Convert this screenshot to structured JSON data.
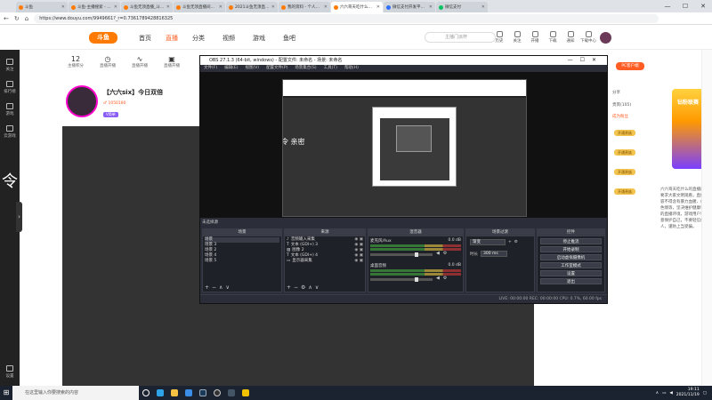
{
  "browser": {
    "tabs": [
      {
        "title": "斗鱼"
      },
      {
        "title": "斗鱼-主播搜索 - 斗鱼直…"
      },
      {
        "title": "斗鱼无须直播_斗鱼直播间…"
      },
      {
        "title": "斗鱼无须直播间直播…"
      },
      {
        "title": "2021斗鱼无须直播间直播…"
      },
      {
        "title": "我的资料 - 个人中心 - 斗鱼"
      },
      {
        "title": "六六哥天吃什么直播_斗鱼…"
      },
      {
        "title": "微信支付开发平台_百度搜索"
      },
      {
        "title": "微信支付"
      }
    ],
    "url": "https://www.douyu.com/9949661?_r=0.7361789428816325",
    "window_controls": [
      "—",
      "☐",
      "✕"
    ]
  },
  "douyu": {
    "logo_text": "斗鱼",
    "nav": [
      "首页",
      "直播",
      "分类",
      "视频",
      "游戏",
      "鱼吧"
    ],
    "nav_active_index": 1,
    "search_placeholder": "主播门派杯",
    "tools": [
      "历史",
      "关注",
      "开播",
      "下载",
      "通知",
      "下载中心"
    ],
    "room_top": [
      {
        "value": "12",
        "label": "主播积分"
      },
      {
        "value": "",
        "label": "直播开播"
      },
      {
        "value": "",
        "label": "直播开播"
      },
      {
        "value": "",
        "label": "直播开播"
      }
    ],
    "room_title": "【六六six】今日双倍",
    "room_tag": "♂ 1050180",
    "room_badge": "V简单",
    "player_text": "令 亲密"
  },
  "left_sidebar": [
    "关注",
    "排行榜",
    "游戏",
    "云游戏",
    "设置"
  ],
  "right_rail": {
    "pc_client": "PC客户端",
    "lines": [
      "分享",
      "贵宾(105)",
      "成为粉丝"
    ],
    "pills": [
      "开通贵族",
      "开通贵族",
      "开通贵族",
      "开通贵族"
    ],
    "text": "六六哥天吃什么的直播间，要求大家文明观看，直播内容不得含有暴力血腥、低俗色情等，坚决维护健康和谐的直播环境，游戏用户请注意保护自己，不要轻信他人，谨防上当受骗。",
    "ad_text": "钻粉联赛"
  },
  "obs": {
    "title": "OBS 27.1.3 (64-bit, windows) - 配置文件: 未命名 - 场景: 未命名",
    "menu": [
      "文件(F)",
      "编辑(E)",
      "视图(V)",
      "配置文件(P)",
      "场景集合(S)",
      "工具(T)",
      "帮助(H)"
    ],
    "not_selected_source": "未选择源",
    "preview_text": "令 亲密",
    "docks": {
      "scenes": {
        "title": "场景",
        "items": [
          "场景",
          "场景 3",
          "场景 2",
          "场景 4",
          "场景 5"
        ]
      },
      "sources": {
        "title": "来源",
        "items": [
          "音频输入采集",
          "文本 (GDI+) 3",
          "图像 2",
          "文本 (GDI+) 4",
          "显示器采集"
        ]
      },
      "mixer": {
        "title": "混音器",
        "channels": [
          {
            "name": "麦克风/Aux",
            "db": "0.0 dB"
          },
          {
            "name": "桌面音频",
            "db": "0.0 dB"
          }
        ]
      },
      "transitions": {
        "title": "场景过渡",
        "type": "渐变",
        "duration_label": "时长",
        "duration": "300 ms"
      },
      "controls": {
        "title": "控件",
        "buttons": [
          "停止推流",
          "开始录制",
          "启动虚拟摄像机",
          "工作室模式",
          "设置",
          "退出"
        ]
      }
    },
    "status": "LIVE: 00:00:00    REC: 00:00:00    CPU: 0.7%, 60.00 fps"
  },
  "taskbar": {
    "search_placeholder": "在这里输入你要搜索的内容",
    "clock_time": "19:11",
    "clock_date": "2021/11/19",
    "apps": [
      "task-view",
      "edge",
      "file-explorer",
      "store",
      "steam",
      "obs",
      "unknown",
      "yellow-app"
    ]
  },
  "colors": {
    "douyu_orange": "#ff7a00",
    "douyu_accent": "#ff5d23",
    "obs_bg": "#2b2e38",
    "taskbar": "#1c2330"
  }
}
